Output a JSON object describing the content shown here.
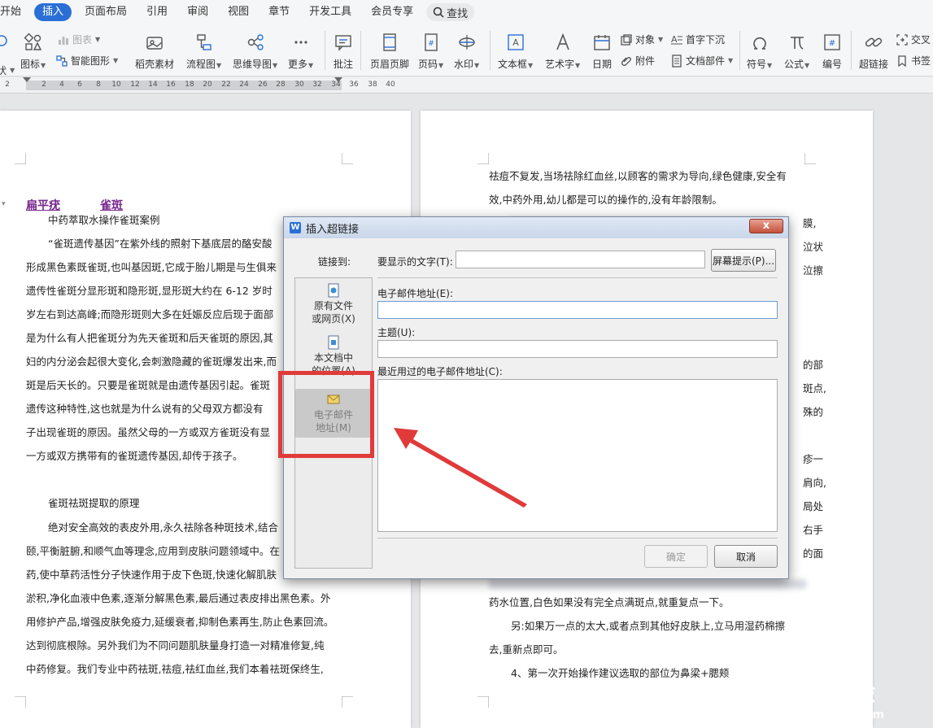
{
  "menu": {
    "items": [
      "开始",
      "插入",
      "页面布局",
      "引用",
      "审阅",
      "视图",
      "章节",
      "开发工具",
      "会员专享"
    ],
    "active_index": 1,
    "search": "查找"
  },
  "ribbon": {
    "shape": "状",
    "icon": "图标",
    "chart": "图表",
    "smart_shape": "智能图形",
    "daoke": "稻壳素材",
    "flowchart": "流程图",
    "mindmap": "思维导图",
    "more": "更多",
    "comment": "批注",
    "header_footer": "页眉页脚",
    "page_number": "页码",
    "watermark": "水印",
    "textbox": "文本框",
    "wordart": "艺术字",
    "date": "日期",
    "object": "对象",
    "attachment": "附件",
    "drop_cap": "首字下沉",
    "doc_parts": "文档部件",
    "symbol": "符号",
    "formula": "公式",
    "numbering": "编号",
    "hyperlink": "超链接",
    "cross_ref": "交叉",
    "bookmark": "书签"
  },
  "ruler": {
    "labels": [
      "2",
      "2",
      "4",
      "6",
      "8",
      "10",
      "12",
      "14",
      "16",
      "18",
      "20",
      "22",
      "24",
      "26",
      "28",
      "30",
      "32",
      "34",
      "36",
      "38",
      "40"
    ]
  },
  "doc_left": {
    "link1": "扁平疣",
    "link2": "雀斑",
    "lines": [
      "中药萃取水操作雀斑案例",
      "“雀斑遗传基因”在紫外线的照射下基底层的酪安酸",
      "形成黑色素既雀斑,也叫基因斑,它成于胎儿期是与生俱来",
      "遗传性雀斑分显形斑和隐形斑,显形斑大约在 6-12 岁时",
      "岁左右到达高峰;而隐形斑则大多在妊娠反应后现于面部",
      "是为什么有人把雀斑分为先天雀斑和后天雀斑的原因,其",
      "妇的内分泌会起很大变化,会刺激隐藏的雀斑爆发出来,而",
      "斑是后天长的。只要是雀斑就是由遗传基因引起。雀斑",
      "遗传这种特性,这也就是为什么说有的父母双方都没有",
      "子出现雀斑的原因。虽然父母的一方或双方雀斑没有显",
      "一方或双方携带有的雀斑遗传基因,却传于孩子。",
      "雀斑祛斑提取的原理",
      "绝对安全高效的表皮外用,永久祛除各种斑技术,结合",
      "颐,平衡脏腑,和顺气血等理念,应用到皮肤问题领域中。在",
      "药,使中草药活性分子快速作用于皮下色斑,快速化解肌肤",
      "淤积,净化血液中色素,逐渐分解黑色素,最后通过表皮排出黑色素。外",
      "用修护产品,增强皮肤免疫力,延缓衰者,抑制色素再生,防止色素回流。",
      "达到彻底根除。另外我们为不同问题肌肤量身打造一对精准修复,纯",
      "中药修复。我们专业中药祛斑,祛痘,祛红血丝,我们本着祛斑保终生,"
    ]
  },
  "doc_right": {
    "lines": [
      "祛痘不复发,当场祛除红血丝,以顾客的需求为导向,绿色健康,安全有",
      "效,中药外用,幼儿都是可以的操作的,没有年龄限制。",
      "药水位置,白色如果没有完全点满斑点,就重复点一下。",
      "另:如果万一点的太大,或者点到其他好皮肤上,立马用湿药棉擦",
      "去,重新点即可。",
      "4、第一次开始操作建议选取的部位为鼻梁+腮颊"
    ],
    "edge": [
      "膜,",
      "泣状",
      "泣擦",
      "的部",
      "斑点,",
      "殊的",
      "疹一",
      "肩向,",
      "局处",
      "右手",
      "的面"
    ]
  },
  "dialog": {
    "title": "插入超链接",
    "close": "x",
    "link_to_label": "链接到:",
    "display_text_label": "要显示的文字(T):",
    "display_text_value": "",
    "screen_tip_button": "屏幕提示(P)...",
    "email_label": "电子邮件地址(E):",
    "email_value": "",
    "subject_label": "主题(U):",
    "subject_value": "",
    "recent_label": "最近用过的电子邮件地址(C):",
    "ok": "确定",
    "cancel": "取消",
    "nav": [
      {
        "line1": "原有文件",
        "line2": "或网页(X)"
      },
      {
        "line1": "本文档中",
        "line2": "的位置(A)"
      },
      {
        "line1": "电子邮件",
        "line2": "地址(M)"
      }
    ]
  },
  "watermark": {
    "brand": "Bai 经验",
    "url": "jingyan.baidu.com"
  },
  "colors": {
    "accent": "#2b6fd6",
    "highlight": "#e03a3a",
    "link": "#7a2a8f"
  }
}
